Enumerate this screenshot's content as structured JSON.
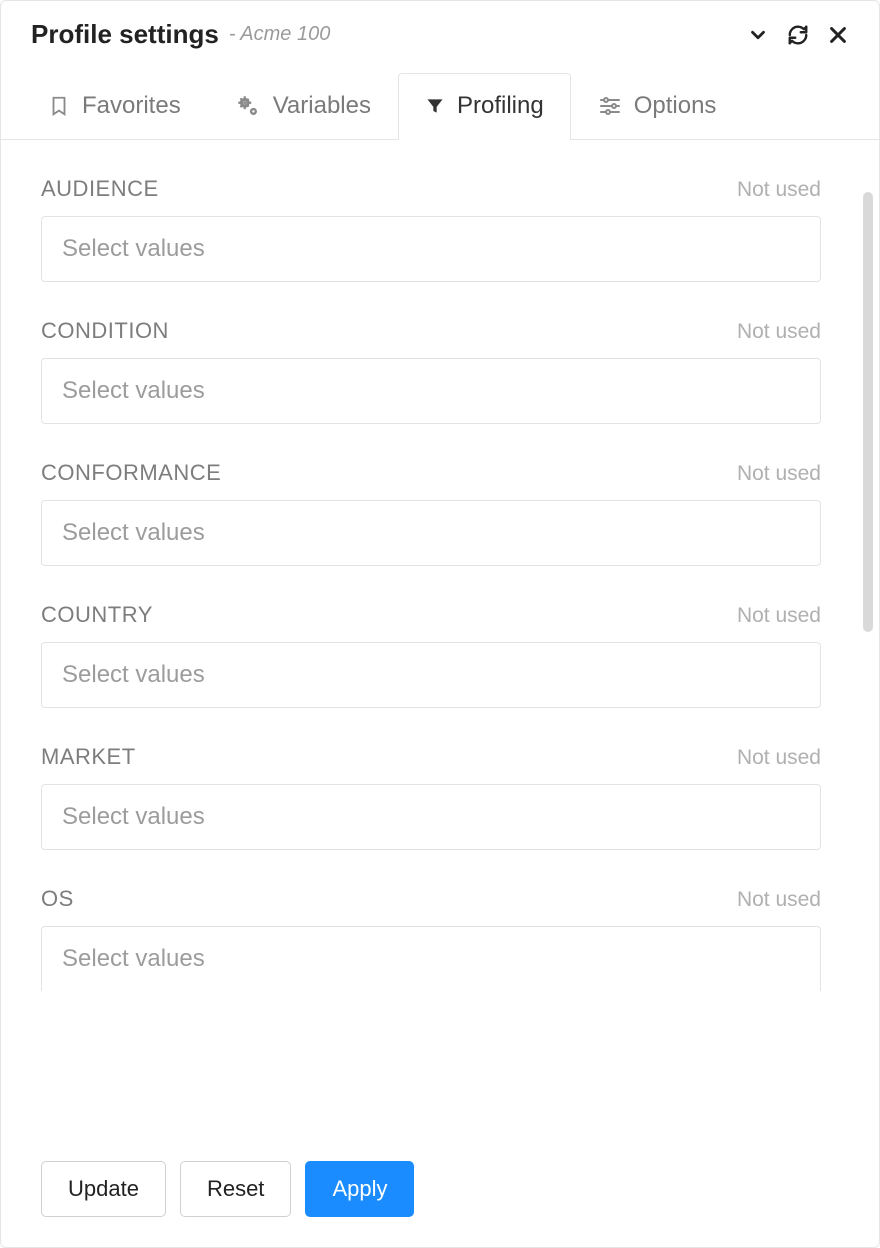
{
  "header": {
    "title": "Profile settings",
    "subtitle": "- Acme 100"
  },
  "tabs": [
    {
      "id": "favorites",
      "label": "Favorites",
      "active": false
    },
    {
      "id": "variables",
      "label": "Variables",
      "active": false
    },
    {
      "id": "profiling",
      "label": "Profiling",
      "active": true
    },
    {
      "id": "options",
      "label": "Options",
      "active": false
    }
  ],
  "fields": [
    {
      "id": "audience",
      "label": "AUDIENCE",
      "status": "Not used",
      "placeholder": "Select values"
    },
    {
      "id": "condition",
      "label": "CONDITION",
      "status": "Not used",
      "placeholder": "Select values"
    },
    {
      "id": "conformance",
      "label": "CONFORMANCE",
      "status": "Not used",
      "placeholder": "Select values"
    },
    {
      "id": "country",
      "label": "COUNTRY",
      "status": "Not used",
      "placeholder": "Select values"
    },
    {
      "id": "market",
      "label": "MARKET",
      "status": "Not used",
      "placeholder": "Select values"
    },
    {
      "id": "os",
      "label": "OS",
      "status": "Not used",
      "placeholder": "Select values"
    }
  ],
  "footer": {
    "update": "Update",
    "reset": "Reset",
    "apply": "Apply"
  }
}
